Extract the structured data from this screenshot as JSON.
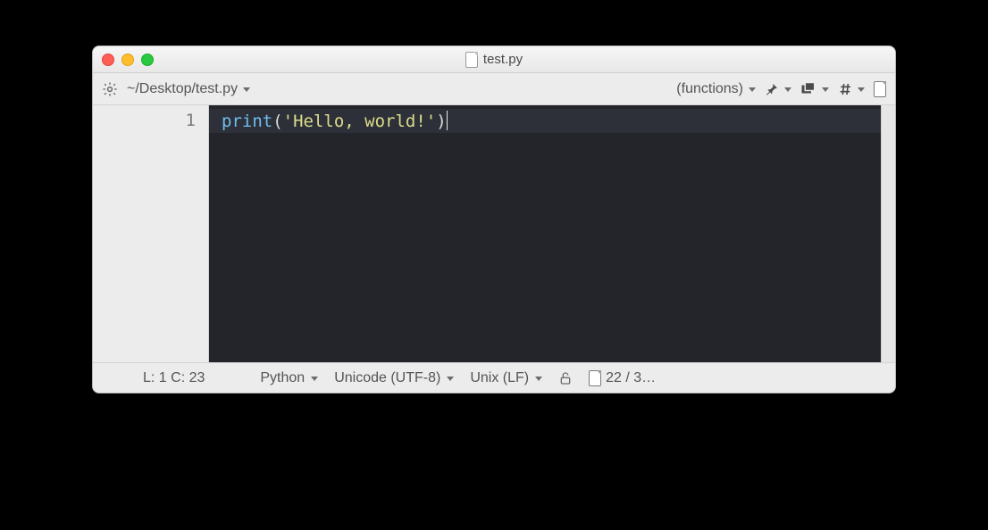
{
  "window": {
    "title": "test.py"
  },
  "toolbar": {
    "file_path": "~/Desktop/test.py",
    "functions_label": "(functions)"
  },
  "editor": {
    "line_numbers": [
      "1"
    ],
    "code": {
      "fn": "print",
      "open": "(",
      "str": "'Hello, world!'",
      "close": ")"
    }
  },
  "status": {
    "cursor": "L: 1 C: 23",
    "language": "Python",
    "encoding": "Unicode (UTF-8)",
    "line_ending": "Unix (LF)",
    "doc_stats": "22 / 3…"
  }
}
